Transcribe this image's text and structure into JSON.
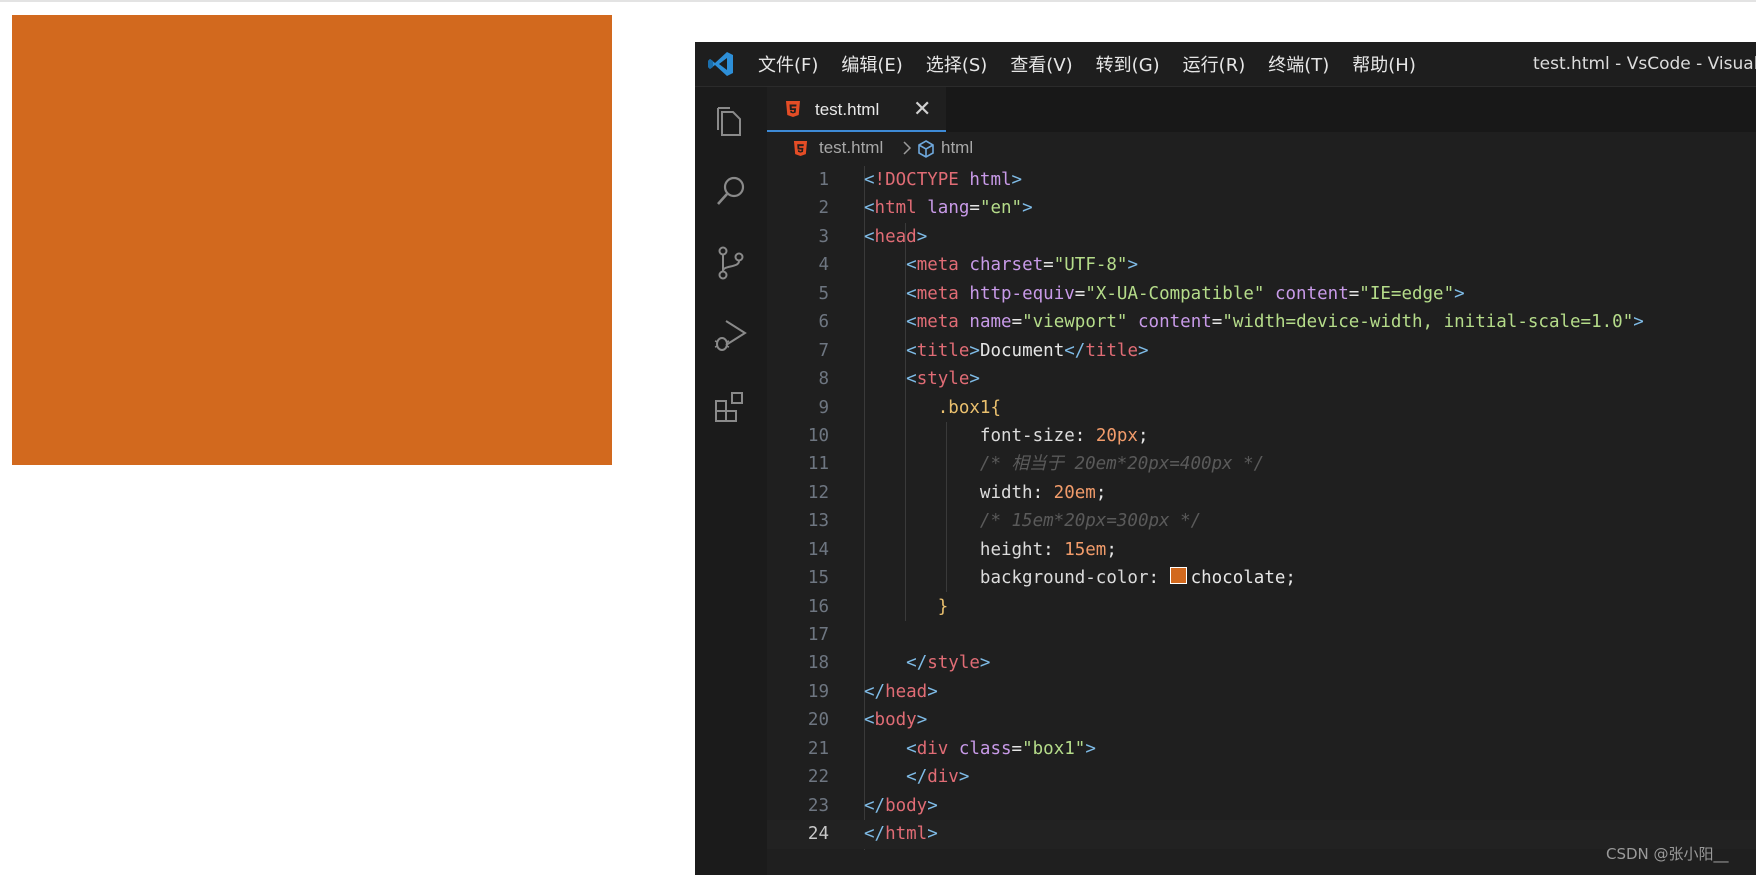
{
  "preview": {
    "box_color": "#d2691e"
  },
  "titlebar": {
    "logo_icon": "vscode-logo-icon",
    "menu": [
      "文件(F)",
      "编辑(E)",
      "选择(S)",
      "查看(V)",
      "转到(G)",
      "运行(R)",
      "终端(T)",
      "帮助(H)"
    ],
    "window_title": "test.html - VsCode - Visual S"
  },
  "activitybar": {
    "icons": [
      "explorer-icon",
      "search-icon",
      "source-control-icon",
      "run-debug-icon",
      "extensions-icon"
    ]
  },
  "tab": {
    "label": "test.html",
    "close": "✕",
    "icon": "html5-icon"
  },
  "breadcrumb": {
    "file": "test.html",
    "separator": "chevron-right-icon",
    "node": "html",
    "node_icon": "cube-icon"
  },
  "code": {
    "current_line": 24,
    "swatch_color": "#d2691e",
    "lines": [
      {
        "n": "1",
        "tokens": [
          [
            "angle",
            "<"
          ],
          [
            "doctype",
            "!DOCTYPE"
          ],
          [
            "text",
            " "
          ],
          [
            "attr",
            "html"
          ],
          [
            "angle",
            ">"
          ]
        ]
      },
      {
        "n": "2",
        "tokens": [
          [
            "angle",
            "<"
          ],
          [
            "tag",
            "html"
          ],
          [
            "text",
            " "
          ],
          [
            "attr",
            "lang"
          ],
          [
            "text",
            "="
          ],
          [
            "str",
            "\"en\""
          ],
          [
            "angle",
            ">"
          ]
        ]
      },
      {
        "n": "3",
        "tokens": [
          [
            "angle",
            "<"
          ],
          [
            "tag",
            "head"
          ],
          [
            "angle",
            ">"
          ]
        ]
      },
      {
        "n": "4",
        "tokens": [
          [
            "text",
            "    "
          ],
          [
            "angle",
            "<"
          ],
          [
            "tag",
            "meta"
          ],
          [
            "text",
            " "
          ],
          [
            "attr",
            "charset"
          ],
          [
            "text",
            "="
          ],
          [
            "str",
            "\"UTF-8\""
          ],
          [
            "angle",
            ">"
          ]
        ]
      },
      {
        "n": "5",
        "tokens": [
          [
            "text",
            "    "
          ],
          [
            "angle",
            "<"
          ],
          [
            "tag",
            "meta"
          ],
          [
            "text",
            " "
          ],
          [
            "attr",
            "http-equiv"
          ],
          [
            "text",
            "="
          ],
          [
            "str",
            "\"X-UA-Compatible\""
          ],
          [
            "text",
            " "
          ],
          [
            "attr",
            "content"
          ],
          [
            "text",
            "="
          ],
          [
            "str",
            "\"IE=edge\""
          ],
          [
            "angle",
            ">"
          ]
        ]
      },
      {
        "n": "6",
        "tokens": [
          [
            "text",
            "    "
          ],
          [
            "angle",
            "<"
          ],
          [
            "tag",
            "meta"
          ],
          [
            "text",
            " "
          ],
          [
            "attr",
            "name"
          ],
          [
            "text",
            "="
          ],
          [
            "str",
            "\"viewport\""
          ],
          [
            "text",
            " "
          ],
          [
            "attr",
            "content"
          ],
          [
            "text",
            "="
          ],
          [
            "str",
            "\"width=device-width, initial-scale=1.0\""
          ],
          [
            "angle",
            ">"
          ]
        ]
      },
      {
        "n": "7",
        "tokens": [
          [
            "text",
            "    "
          ],
          [
            "angle",
            "<"
          ],
          [
            "tag",
            "title"
          ],
          [
            "angle",
            ">"
          ],
          [
            "text",
            "Document"
          ],
          [
            "angle",
            "</"
          ],
          [
            "tag",
            "title"
          ],
          [
            "angle",
            ">"
          ]
        ]
      },
      {
        "n": "8",
        "tokens": [
          [
            "text",
            "    "
          ],
          [
            "angle",
            "<"
          ],
          [
            "tag",
            "style"
          ],
          [
            "angle",
            ">"
          ]
        ]
      },
      {
        "n": "9",
        "tokens": [
          [
            "text",
            "       "
          ],
          [
            "sel",
            ".box1{"
          ]
        ]
      },
      {
        "n": "10",
        "tokens": [
          [
            "text",
            "           "
          ],
          [
            "prop",
            "font-size"
          ],
          [
            "text",
            ": "
          ],
          [
            "num",
            "20px"
          ],
          [
            "text",
            ";"
          ]
        ]
      },
      {
        "n": "11",
        "tokens": [
          [
            "text",
            "           "
          ],
          [
            "comment",
            "/* 相当于 20em*20px=400px */"
          ]
        ]
      },
      {
        "n": "12",
        "tokens": [
          [
            "text",
            "           "
          ],
          [
            "prop",
            "width"
          ],
          [
            "text",
            ": "
          ],
          [
            "num",
            "20em"
          ],
          [
            "text",
            ";"
          ]
        ]
      },
      {
        "n": "13",
        "tokens": [
          [
            "text",
            "           "
          ],
          [
            "comment",
            "/* 15em*20px=300px */"
          ]
        ]
      },
      {
        "n": "14",
        "tokens": [
          [
            "text",
            "           "
          ],
          [
            "prop",
            "height"
          ],
          [
            "text",
            ": "
          ],
          [
            "num",
            "15em"
          ],
          [
            "text",
            ";"
          ]
        ]
      },
      {
        "n": "15",
        "tokens": [
          [
            "text",
            "           "
          ],
          [
            "prop",
            "background-color"
          ],
          [
            "text",
            ": "
          ],
          [
            "swatch",
            ""
          ],
          [
            "text",
            "chocolate;"
          ]
        ]
      },
      {
        "n": "16",
        "tokens": [
          [
            "text",
            "       "
          ],
          [
            "sel",
            "}"
          ]
        ]
      },
      {
        "n": "17",
        "tokens": []
      },
      {
        "n": "18",
        "tokens": [
          [
            "text",
            "    "
          ],
          [
            "angle",
            "</"
          ],
          [
            "tag",
            "style"
          ],
          [
            "angle",
            ">"
          ]
        ]
      },
      {
        "n": "19",
        "tokens": [
          [
            "angle",
            "</"
          ],
          [
            "tag",
            "head"
          ],
          [
            "angle",
            ">"
          ]
        ]
      },
      {
        "n": "20",
        "tokens": [
          [
            "angle",
            "<"
          ],
          [
            "tag",
            "body"
          ],
          [
            "angle",
            ">"
          ]
        ]
      },
      {
        "n": "21",
        "tokens": [
          [
            "text",
            "    "
          ],
          [
            "angle",
            "<"
          ],
          [
            "tag",
            "div"
          ],
          [
            "text",
            " "
          ],
          [
            "attr",
            "class"
          ],
          [
            "text",
            "="
          ],
          [
            "str",
            "\"box1\""
          ],
          [
            "angle",
            ">"
          ]
        ]
      },
      {
        "n": "22",
        "tokens": [
          [
            "text",
            "    "
          ],
          [
            "angle",
            "</"
          ],
          [
            "tag",
            "div"
          ],
          [
            "angle",
            ">"
          ]
        ]
      },
      {
        "n": "23",
        "tokens": [
          [
            "angle",
            "</"
          ],
          [
            "tag",
            "body"
          ],
          [
            "angle",
            ">"
          ]
        ]
      },
      {
        "n": "24",
        "tokens": [
          [
            "angle",
            "</"
          ],
          [
            "tag",
            "html"
          ],
          [
            "angle",
            ">"
          ]
        ]
      }
    ]
  },
  "watermark": "CSDN @张小阳__"
}
